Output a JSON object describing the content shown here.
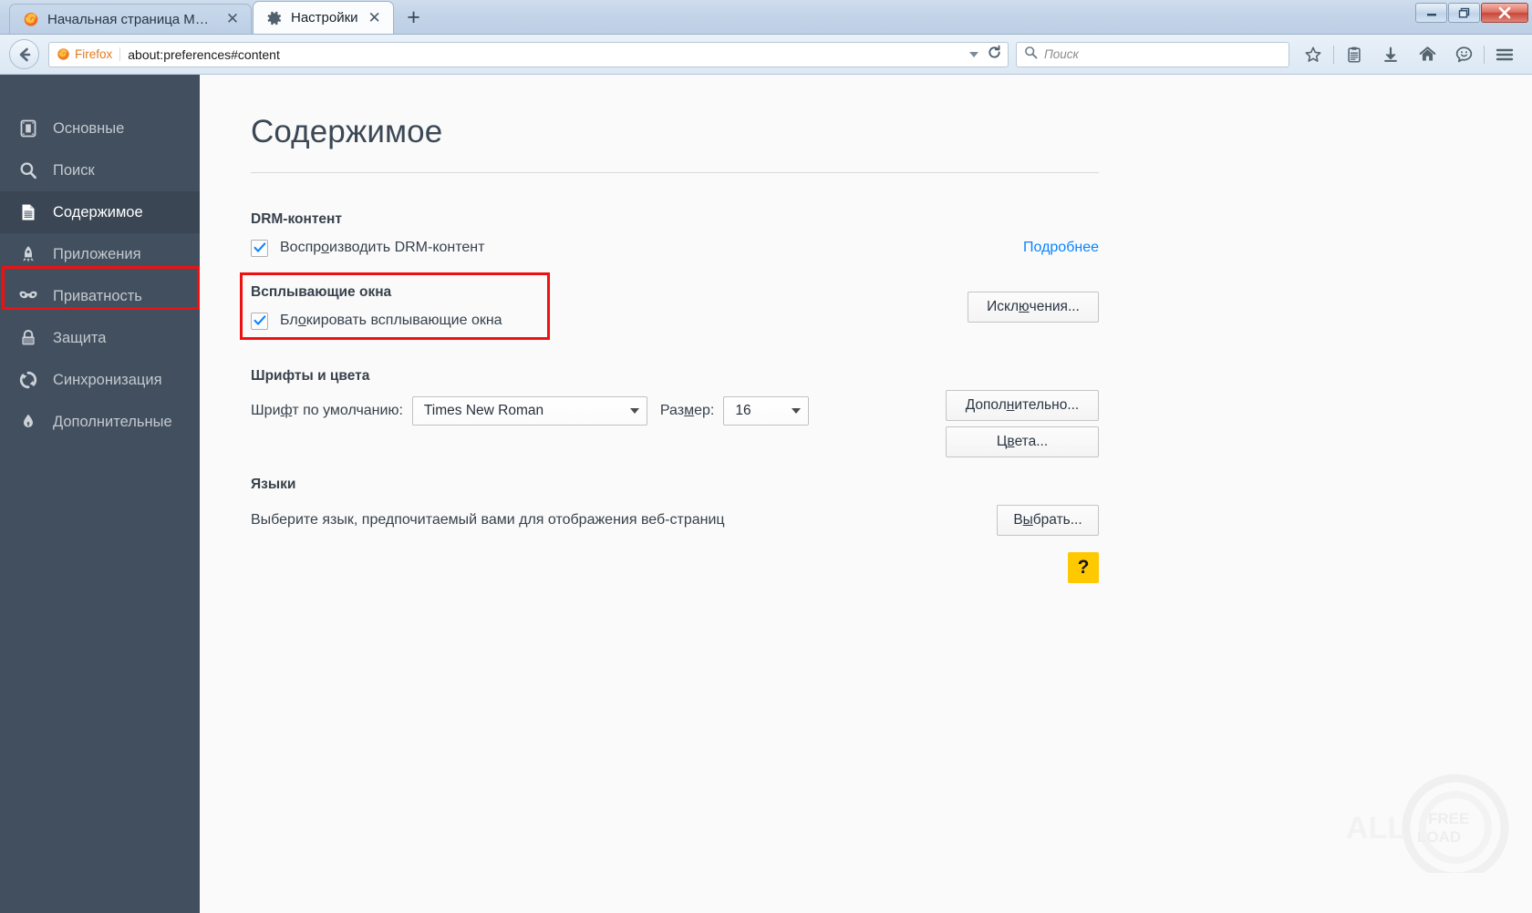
{
  "window": {
    "minimize_label": "Свернуть",
    "maximize_label": "Развернуть",
    "close_label": "Закрыть"
  },
  "tabs": [
    {
      "title": "Начальная страница Moz...",
      "icon": "firefox-icon",
      "active": false,
      "close_label": "✕"
    },
    {
      "title": "Настройки",
      "icon": "gear-icon",
      "active": true,
      "close_label": "✕"
    }
  ],
  "newtab_label": "+",
  "navbar": {
    "identity_label": "Firefox",
    "url": "about:preferences#content",
    "search_placeholder": "Поиск",
    "icons": [
      "bookmark-star-icon",
      "reading-list-icon",
      "downloads-icon",
      "home-icon",
      "chat-icon",
      "menu-icon"
    ]
  },
  "sidebar": {
    "items": [
      {
        "label": "Основные",
        "icon": "general-icon",
        "selected": false
      },
      {
        "label": "Поиск",
        "icon": "search-icon",
        "selected": false
      },
      {
        "label": "Содержимое",
        "icon": "content-icon",
        "selected": true
      },
      {
        "label": "Приложения",
        "icon": "applications-icon",
        "selected": false
      },
      {
        "label": "Приватность",
        "icon": "privacy-mask-icon",
        "selected": false
      },
      {
        "label": "Защита",
        "icon": "security-lock-icon",
        "selected": false
      },
      {
        "label": "Синхронизация",
        "icon": "sync-icon",
        "selected": false
      },
      {
        "label": "Дополнительные",
        "icon": "advanced-icon",
        "selected": false
      }
    ]
  },
  "main": {
    "page_title": "Содержимое",
    "drm": {
      "heading": "DRM-контент",
      "checkbox_label_pre": "Воспр",
      "checkbox_label_accel": "о",
      "checkbox_label_post": "изводить DRM-контент",
      "checkbox_label": "Воспроизводить DRM-контент",
      "checked": true,
      "link_label": "Подробнее"
    },
    "popups": {
      "heading": "Всплывающие окна",
      "checkbox_label": "Блокировать всплывающие окна",
      "checkbox_label_pre": "Бл",
      "checkbox_label_accel": "о",
      "checkbox_label_post": "кировать всплывающие окна",
      "checked": true,
      "button_label": "Исключения...",
      "button_pre": "Искл",
      "button_accel": "ю",
      "button_post": "чения..."
    },
    "fonts": {
      "heading": "Шрифты и цвета",
      "font_label": "Шрифт по умолчанию:",
      "font_label_pre": "Шри",
      "font_label_accel": "ф",
      "font_label_post": "т по умолчанию:",
      "font_value": "Times New Roman",
      "size_label": "Размер:",
      "size_label_pre": "Раз",
      "size_label_accel": "м",
      "size_label_post": "ер:",
      "size_value": "16",
      "advanced_button": "Дополнительно...",
      "advanced_pre": "Допол",
      "advanced_accel": "н",
      "advanced_post": "ительно...",
      "colors_button": "Цвета...",
      "colors_pre": "Ц",
      "colors_accel": "в",
      "colors_post": "ета..."
    },
    "languages": {
      "heading": "Языки",
      "description": "Выберите язык, предпочитаемый вами для отображения веб-страниц",
      "button_label": "Выбрать...",
      "button_pre": "В",
      "button_accel": "ы",
      "button_post": "брать..."
    },
    "help_badge": "?"
  },
  "colors": {
    "sidebar_bg": "#424f5e",
    "sidebar_selected_bg": "#3a4654",
    "highlight_red": "#ee1111",
    "link_blue": "#0a84ff",
    "checkbox_blue": "#0a84ff",
    "help_yellow": "#fec900",
    "content_bg": "#fafafa",
    "identity_orange": "#e07b20"
  }
}
